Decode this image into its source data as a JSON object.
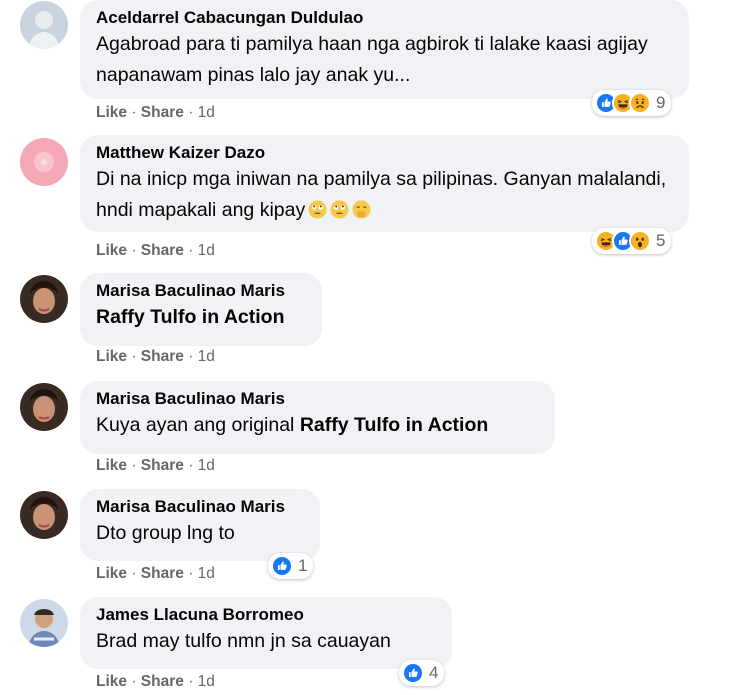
{
  "comments": [
    {
      "author": "Aceldarrel Cabacungan Duldulao",
      "text": "Agabroad para ti pamilya haan nga agbirok ti lalake kaasi agijay napanawam pinas lalo jay anak yu...",
      "like": "Like",
      "share": "Share",
      "time": "1d",
      "reactions": [
        "like",
        "haha",
        "sad"
      ],
      "reaction_count": "9"
    },
    {
      "author": "Matthew Kaizer Dazo",
      "text": "Di na inicp mga iniwan na pamilya sa pilipinas. Ganyan malalandi, hndi mapakali ang kipay",
      "like": "Like",
      "share": "Share",
      "time": "1d",
      "reactions": [
        "haha",
        "like",
        "wow"
      ],
      "reaction_count": "5"
    },
    {
      "author": "Marisa Baculinao Maris",
      "text": "Raffy Tulfo in Action",
      "like": "Like",
      "share": "Share",
      "time": "1d"
    },
    {
      "author": "Marisa Baculinao Maris",
      "text_prefix": "Kuya ayan ang original ",
      "text_bold": "Raffy Tulfo in Action",
      "like": "Like",
      "share": "Share",
      "time": "1d"
    },
    {
      "author": "Marisa Baculinao Maris",
      "text": "Dto group lng to",
      "like": "Like",
      "share": "Share",
      "time": "1d",
      "reactions": [
        "like"
      ],
      "reaction_count": "1"
    },
    {
      "author": "James Llacuna Borromeo",
      "text": "Brad may tulfo nmn jn sa cauayan",
      "like": "Like",
      "share": "Share",
      "time": "1d",
      "reactions": [
        "like"
      ],
      "reaction_count": "4"
    }
  ],
  "separator": " · ",
  "colors": {
    "bubble": "#f0f2f5",
    "meta": "#65676b",
    "like_blue": "#1877f2",
    "haha_yellow": "#f7b125"
  }
}
